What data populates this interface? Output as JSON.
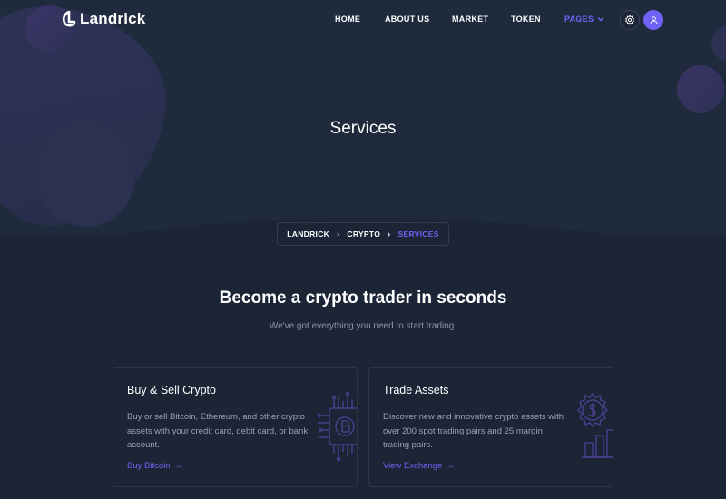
{
  "brand": {
    "name": "Landrick"
  },
  "nav": {
    "items": [
      "HOME",
      "ABOUT US",
      "MARKET",
      "TOKEN"
    ],
    "active": "PAGES"
  },
  "hero": {
    "title": "Services"
  },
  "breadcrumb": {
    "items": [
      "LANDRICK",
      "CRYPTO"
    ],
    "current": "SERVICES"
  },
  "section": {
    "title": "Become a crypto trader in seconds",
    "subtitle": "We've got everything you need to start trading."
  },
  "cards": [
    {
      "title": "Buy & Sell Crypto",
      "text": "Buy or sell Bitcoin, Ethereum, and other crypto assets with your credit card, debit card, or bank account.",
      "link": "Buy Bitcoin",
      "icon": "bitcoin-chip-icon"
    },
    {
      "title": "Trade Assets",
      "text": "Discover new and innovative crypto assets with over 200 spot trading pairs and 25 margin trading pairs.",
      "link": "View Exchange",
      "icon": "dollar-gear-chart-icon"
    }
  ],
  "colors": {
    "accent": "#6f63f5",
    "background": "#1c2536",
    "hero": "#1f2a3d"
  }
}
